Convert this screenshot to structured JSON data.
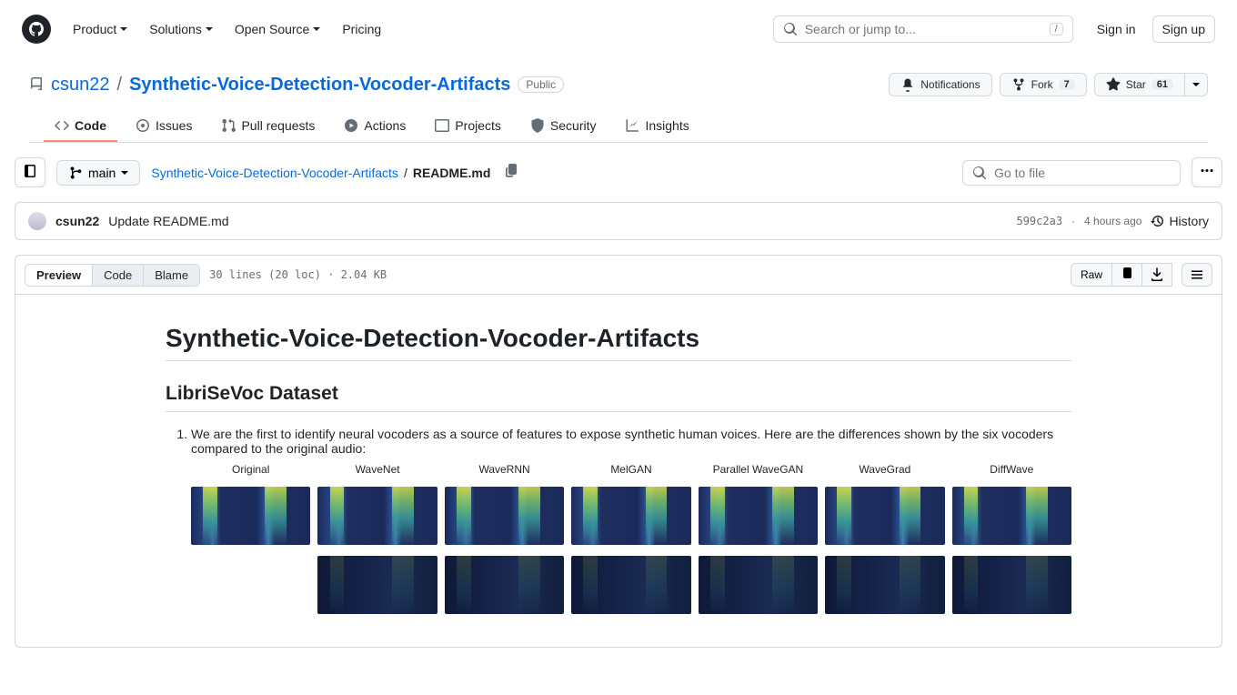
{
  "header": {
    "nav": [
      "Product",
      "Solutions",
      "Open Source",
      "Pricing"
    ],
    "search_placeholder": "Search or jump to...",
    "search_shortcut": "/",
    "signin": "Sign in",
    "signup": "Sign up"
  },
  "repo": {
    "owner": "csun22",
    "name": "Synthetic-Voice-Detection-Vocoder-Artifacts",
    "visibility": "Public",
    "actions": {
      "notifications": "Notifications",
      "fork": "Fork",
      "fork_count": "7",
      "star": "Star",
      "star_count": "61"
    },
    "tabs": [
      "Code",
      "Issues",
      "Pull requests",
      "Actions",
      "Projects",
      "Security",
      "Insights"
    ]
  },
  "file": {
    "branch": "main",
    "breadcrumb_repo": "Synthetic-Voice-Detection-Vocoder-Artifacts",
    "breadcrumb_file": "README.md",
    "goto_placeholder": "Go to file"
  },
  "commit": {
    "author": "csun22",
    "message": "Update README.md",
    "sha": "599c2a3",
    "time": "4 hours ago",
    "history": "History"
  },
  "filebox": {
    "tabs": [
      "Preview",
      "Code",
      "Blame"
    ],
    "meta": "30 lines (20 loc) · 2.04 KB",
    "raw": "Raw"
  },
  "readme": {
    "h1": "Synthetic-Voice-Detection-Vocoder-Artifacts",
    "h2": "LibriSeVoc Dataset",
    "li1": "We are the first to identify neural vocoders as a source of features to expose synthetic human voices. Here are the differences shown by the six vocoders compared to the original audio:",
    "spec_labels": [
      "Original",
      "WaveNet",
      "WaveRNN",
      "MelGAN",
      "Parallel WaveGAN",
      "WaveGrad",
      "DiffWave"
    ]
  }
}
